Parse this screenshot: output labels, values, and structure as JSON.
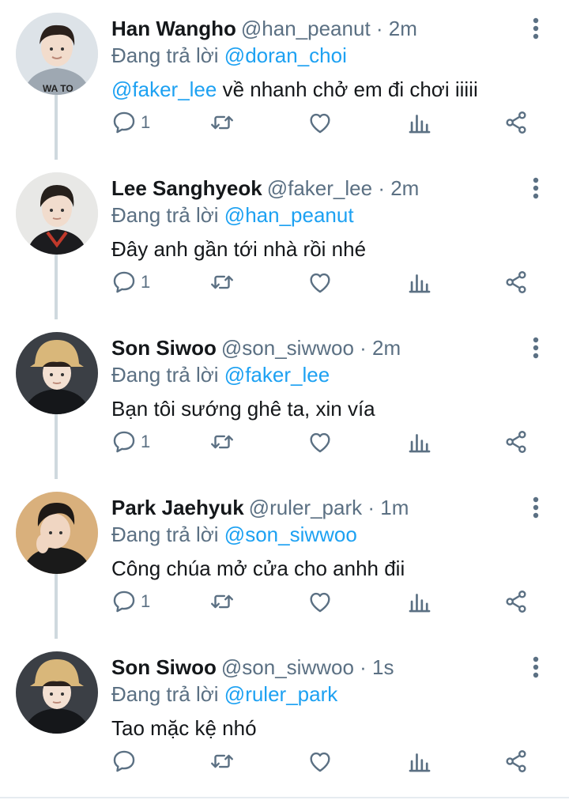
{
  "reply_prefix": "Đang trả lời",
  "colors": {
    "mention": "#1da1f2",
    "secondary_text": "#5b7083",
    "primary_text": "#14171a",
    "thread_line": "#cfd9de"
  },
  "tweets": [
    {
      "name": "Han Wangho",
      "handle": "@han_peanut",
      "time": "2m",
      "reply_to": "@doran_choi",
      "text_mention": "@faker_lee",
      "text": " về nhanh chở em đi chơi iiiii",
      "reply_count": "1",
      "avatar_icon": "avatar-han-wangho"
    },
    {
      "name": "Lee Sanghyeok",
      "handle": "@faker_lee",
      "time": "2m",
      "reply_to": "@han_peanut",
      "text_mention": "",
      "text": "Đây anh gần tới nhà rồi nhé",
      "reply_count": "1",
      "avatar_icon": "avatar-lee-sanghyeok"
    },
    {
      "name": "Son Siwoo",
      "handle": "@son_siwwoo",
      "time": "2m",
      "reply_to": "@faker_lee",
      "text_mention": "",
      "text": "Bạn tôi sướng ghê ta, xin vía",
      "reply_count": "1",
      "avatar_icon": "avatar-son-siwoo"
    },
    {
      "name": "Park Jaehyuk",
      "handle": "@ruler_park",
      "time": "1m",
      "reply_to": "@son_siwwoo",
      "text_mention": "",
      "text": "Công chúa mở cửa cho anhh đii",
      "reply_count": "1",
      "avatar_icon": "avatar-park-jaehyuk"
    },
    {
      "name": "Son Siwoo",
      "handle": "@son_siwwoo",
      "time": "1s",
      "reply_to": "@ruler_park",
      "text_mention": "",
      "text": "Tao mặc kệ nhó",
      "reply_count": "",
      "avatar_icon": "avatar-son-siwoo"
    }
  ]
}
